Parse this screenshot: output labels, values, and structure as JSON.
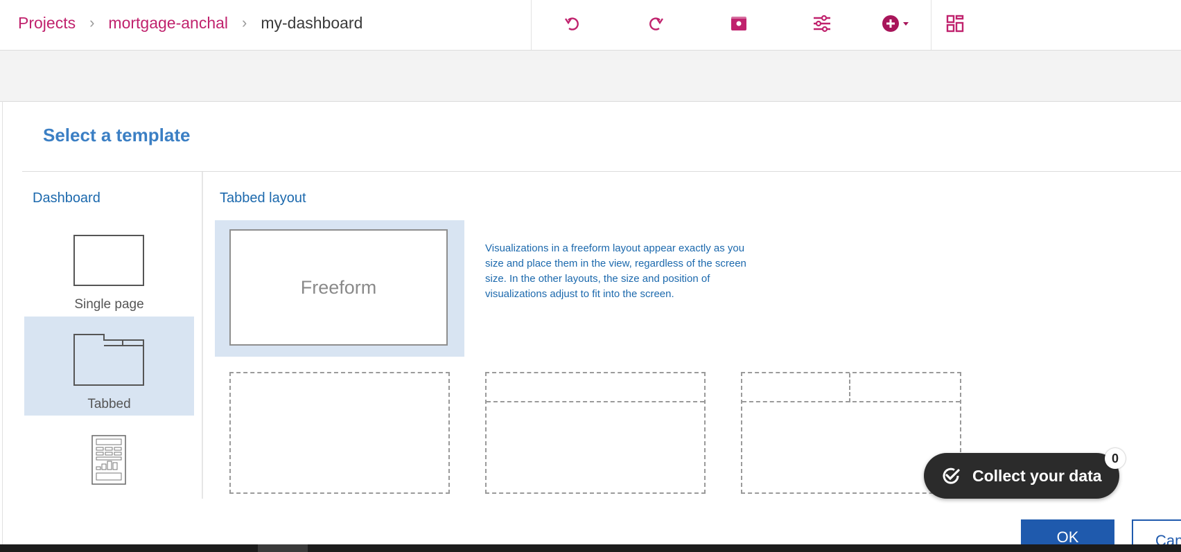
{
  "breadcrumb": {
    "items": [
      "Projects",
      "mortgage-anchal"
    ],
    "current": "my-dashboard",
    "separator": "›"
  },
  "toolbar": {
    "icons": [
      "undo-icon",
      "redo-icon",
      "present-icon",
      "properties-icon",
      "add-icon",
      "widgets-icon"
    ]
  },
  "dialog": {
    "title": "Select a template",
    "sidebar": {
      "heading": "Dashboard",
      "items": [
        {
          "label": "Single page",
          "selected": false
        },
        {
          "label": "Tabbed",
          "selected": true
        },
        {
          "label": "",
          "selected": false
        }
      ]
    },
    "section_heading": "Tabbed layout",
    "templates": [
      {
        "label": "Freeform",
        "selected": true
      }
    ],
    "description": "Visualizations in a freeform layout appear exactly as you size and place them in the view, regardless of the screen size. In the other layouts, the size and position of visualizations adjust to fit into the screen.",
    "ok_label": "OK",
    "cancel_label": "Can"
  },
  "collect": {
    "label": "Collect your data",
    "badge": "0"
  },
  "colors": {
    "brand": "#c0226d",
    "accent": "#1c69ad",
    "title": "#3b7fc4",
    "selection": "#d8e4f2",
    "primary_button": "#1f5aad"
  }
}
